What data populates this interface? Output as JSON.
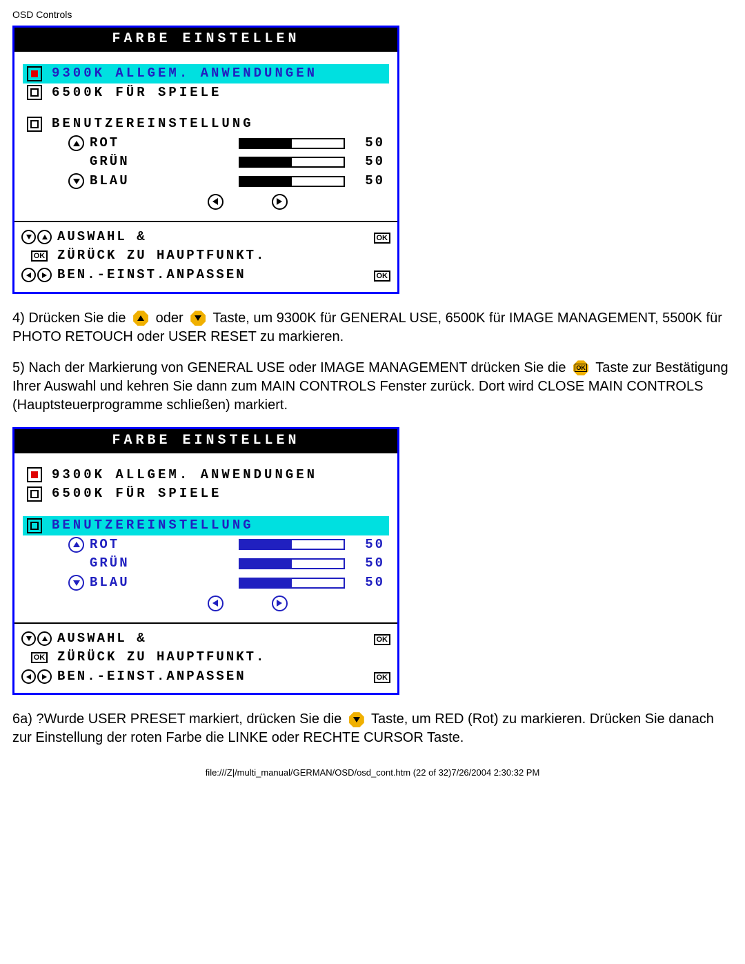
{
  "header": "OSD Controls",
  "panel_title": "FARBE EINSTELLEN",
  "panel1": {
    "row1_label": "9300K ALLGEM. ANWENDUNGEN",
    "row2_label": "6500K FÜR SPIELE",
    "row3_label": "BENUTZEREINSTELLUNG",
    "rgb": {
      "rot": {
        "label": "ROT",
        "value": "50"
      },
      "gruen": {
        "label": "GRÜN",
        "value": "50"
      },
      "blau": {
        "label": "BLAU",
        "value": "50"
      }
    },
    "foot1": "AUSWAHL &",
    "foot2": "ZÜRÜCK ZU HAUPTFUNKT.",
    "foot3": "BEN.-EINST.ANPASSEN",
    "ok": "OK"
  },
  "para4": {
    "a": "4) Drücken Sie die",
    "b": "oder",
    "c": "Taste, um 9300K für GENERAL USE, 6500K für IMAGE MANAGEMENT, 5500K für PHOTO RETOUCH oder USER RESET zu markieren."
  },
  "para5": {
    "a": "5) Nach der Markierung von GENERAL USE oder IMAGE MANAGEMENT drücken Sie die",
    "b": "Taste zur Bestätigung Ihrer Auswahl und kehren Sie dann zum MAIN CONTROLS Fenster zurück. Dort wird CLOSE MAIN CONTROLS (Hauptsteuerprogramme schließen) markiert."
  },
  "para6": {
    "a": "6a) ?Wurde USER PRESET markiert, drücken Sie die",
    "b": "Taste, um RED (Rot) zu markieren. Drücken Sie danach zur Einstellung der roten Farbe die LINKE oder RECHTE CURSOR Taste."
  },
  "footer": "file:///Z|/multi_manual/GERMAN/OSD/osd_cont.htm (22 of 32)7/26/2004 2:30:32 PM"
}
